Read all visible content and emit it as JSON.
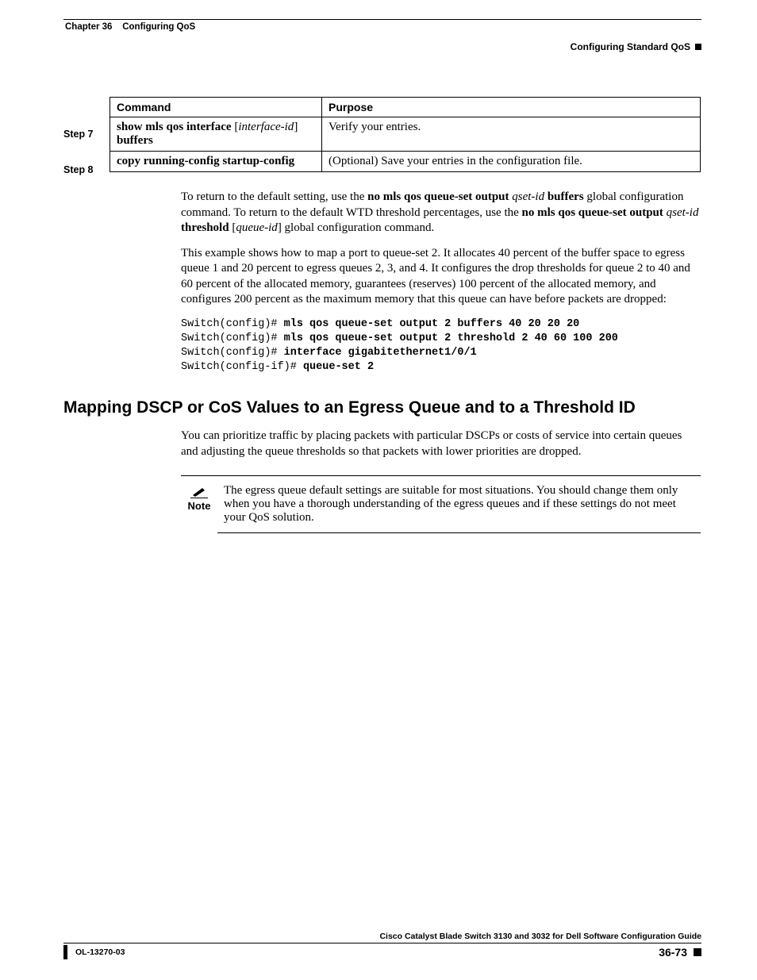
{
  "header": {
    "chapter": "Chapter 36",
    "chapter_title": "Configuring QoS",
    "section": "Configuring Standard QoS"
  },
  "table": {
    "head_command": "Command",
    "head_purpose": "Purpose",
    "rows": [
      {
        "step": "Step 7",
        "cmd_prefix": "show mls qos interface ",
        "cmd_arg": "[interface-id]",
        "cmd_suffix": " buffers",
        "purpose": "Verify your entries."
      },
      {
        "step": "Step 8",
        "cmd_prefix": "copy running-config startup-config",
        "cmd_arg": "",
        "cmd_suffix": "",
        "purpose": "(Optional) Save your entries in the configuration file."
      }
    ]
  },
  "para1": {
    "a": "To return to the default setting, use the ",
    "b": "no mls qos queue-set output",
    "c": " qset-id ",
    "d": "buffers",
    "e": " global configuration command. To return to the default WTD threshold percentages, use the ",
    "f": "no mls qos queue-set output",
    "g": " qset-id ",
    "h": "threshold",
    "i": " [",
    "j": "queue-id",
    "k": "] global configuration command."
  },
  "para2": "This example shows how to map a port to queue-set 2. It allocates 40 percent of the buffer space to egress queue 1 and 20 percent to egress queues 2, 3, and 4. It configures the drop thresholds for queue 2 to 40 and 60 percent of the allocated memory, guarantees (reserves) 100 percent of the allocated memory, and configures 200 percent as the maximum memory that this queue can have before packets are dropped:",
  "code": {
    "l1p": "Switch(config)# ",
    "l1b": "mls qos queue-set output 2 buffers 40 20 20 20",
    "l2p": "Switch(config)# ",
    "l2b": "mls qos queue-set output 2 threshold 2 40 60 100 200",
    "l3p": "Switch(config)# ",
    "l3b": "interface gigabitethernet1/0/1",
    "l4p": "Switch(config-if)# ",
    "l4b": "queue-set 2"
  },
  "heading": "Mapping DSCP or CoS Values to an Egress Queue and to a Threshold ID",
  "para3": "You can prioritize traffic by placing packets with particular DSCPs or costs of service into certain queues and adjusting the queue thresholds so that packets with lower priorities are dropped.",
  "note": {
    "label": "Note",
    "body": "The egress queue default settings are suitable for most situations. You should change them only when you have a thorough understanding of the egress queues and if these settings do not meet your QoS solution."
  },
  "footer": {
    "title": "Cisco Catalyst Blade Switch 3130 and 3032 for Dell Software Configuration Guide",
    "doc": "OL-13270-03",
    "page": "36-73"
  }
}
